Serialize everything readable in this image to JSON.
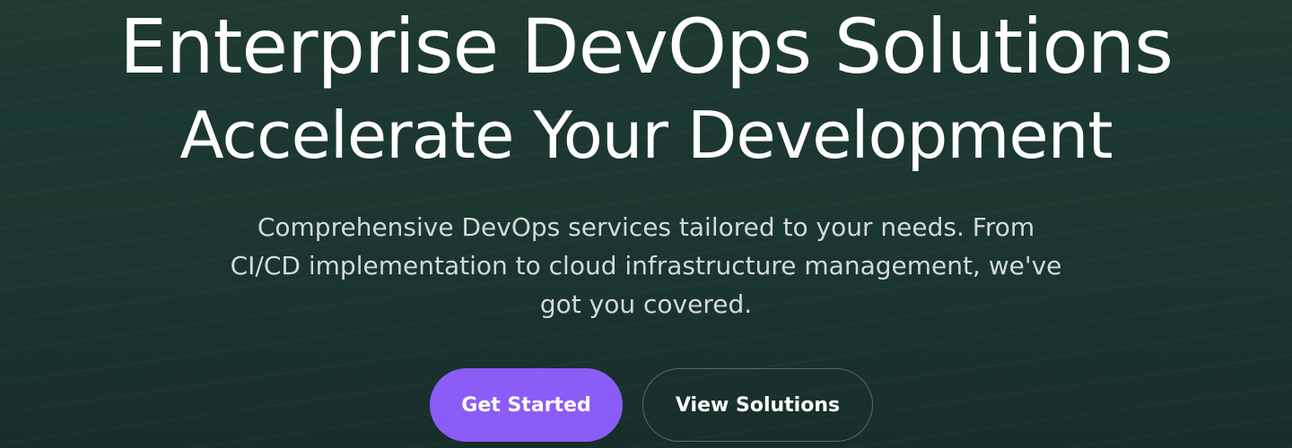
{
  "hero": {
    "title_line_1": "Enterprise DevOps Solutions",
    "title_line_2": "Accelerate Your Development",
    "subtitle_line_1": "Comprehensive DevOps services tailored to your needs. From",
    "subtitle_line_2": "CI/CD implementation to cloud infrastructure management, we've",
    "subtitle_line_3": "got you covered."
  },
  "buttons": {
    "primary_label": "Get Started",
    "secondary_label": "View Solutions"
  },
  "colors": {
    "background": "#1c3731",
    "accent": "#8b5cf6",
    "text": "#ffffff",
    "subtitle_text": "#d2dad7"
  }
}
